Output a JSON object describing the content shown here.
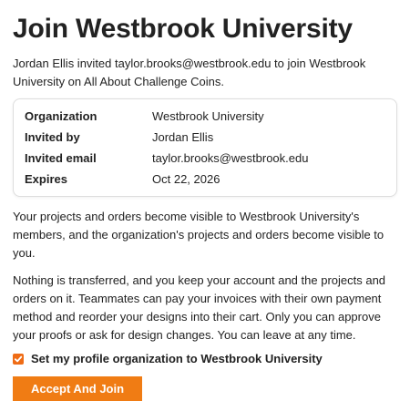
{
  "page": {
    "title": "Join Westbrook University",
    "intro": "Jordan Ellis invited taylor.brooks@westbrook.edu to join Westbrook University on All About Challenge Coins."
  },
  "details": [
    {
      "label": "Organization",
      "value": "Westbrook University"
    },
    {
      "label": "Invited by",
      "value": "Jordan Ellis"
    },
    {
      "label": "Invited email",
      "value": "taylor.brooks@westbrook.edu"
    },
    {
      "label": "Expires",
      "value": "Oct 22, 2026"
    }
  ],
  "paragraphs": {
    "visibility": "Your projects and orders become visible to Westbrook University's members, and the organization's projects and orders become visible to you.",
    "transfer": "Nothing is transferred, and you keep your account and the projects and orders on it. Teammates can pay your invoices with their own payment method and reorder your designs into their cart. Only you can approve your proofs or ask for design changes. You can leave at any time."
  },
  "profile_checkbox": {
    "label": "Set my profile organization to Westbrook University",
    "checked": true
  },
  "accept_button": {
    "label": "Accept And Join"
  },
  "colors": {
    "accent": "#f07c14",
    "text": "#222222",
    "card_border": "#dddddd"
  }
}
